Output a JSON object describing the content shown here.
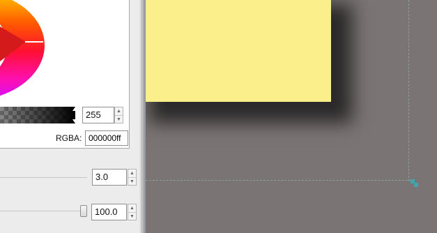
{
  "color_panel": {
    "alpha_value": "255",
    "rgba_label": "RGBA:",
    "rgba_value": "000000ff"
  },
  "properties": {
    "width_value": "3.0",
    "opacity_value": "100.0",
    "opacity_level": 100
  },
  "colors": {
    "note_fill": "#fbef8b",
    "canvas_bg": "#7a7474",
    "guide_handle": "#3ea6ae"
  },
  "icons": {
    "spin_up": "▲",
    "spin_down": "▼"
  }
}
